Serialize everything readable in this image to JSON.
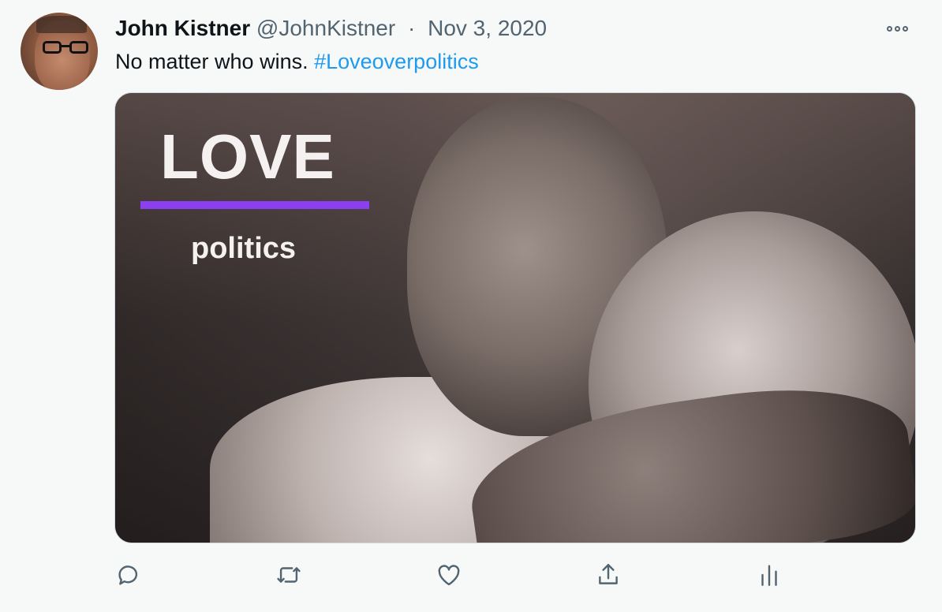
{
  "tweet": {
    "author_name": "John Kistner",
    "author_handle": "@JohnKistner",
    "separator": "·",
    "date": "Nov 3, 2020",
    "text": "No matter who wins. ",
    "hashtag": "#Loveoverpolitics"
  },
  "media": {
    "headline": "LOVE",
    "subline": "politics",
    "accent_color": "#8b3ff0"
  },
  "icons": {
    "more": "more-options-icon",
    "reply": "reply-icon",
    "retweet": "retweet-icon",
    "like": "like-icon",
    "share": "share-icon",
    "analytics": "analytics-icon"
  },
  "colors": {
    "link": "#1d9bf0",
    "text": "#0f1419",
    "secondary": "#536471"
  }
}
